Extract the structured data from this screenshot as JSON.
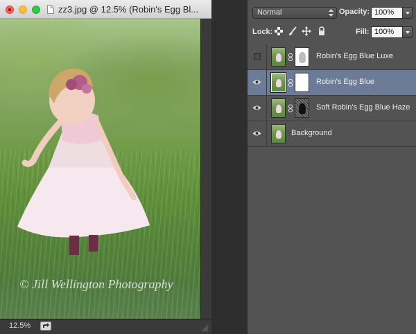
{
  "document": {
    "title": "zz3.jpg @ 12.5% (Robin's Egg Bl...",
    "zoom": "12.5%",
    "watermark": "© Jill Wellington Photography"
  },
  "layers_panel": {
    "blend_mode": "Normal",
    "opacity_label": "Opacity:",
    "opacity_value": "100%",
    "lock_label": "Lock:",
    "fill_label": "Fill:",
    "fill_value": "100%",
    "layers": [
      {
        "name": "Robin's Egg Blue Luxe",
        "visible": false,
        "selected": false,
        "has_mask": true,
        "mask": "silhouette-light"
      },
      {
        "name": "Robin's Egg Blue",
        "visible": true,
        "selected": true,
        "has_mask": true,
        "mask": "white"
      },
      {
        "name": "Soft Robin's Egg Blue Haze",
        "visible": true,
        "selected": false,
        "has_mask": true,
        "mask": "noise-silhouette"
      },
      {
        "name": "Background",
        "visible": true,
        "selected": false,
        "has_mask": false
      }
    ]
  },
  "colors": {
    "selected_layer": "#6c7b97",
    "panel_bg": "#535353"
  }
}
